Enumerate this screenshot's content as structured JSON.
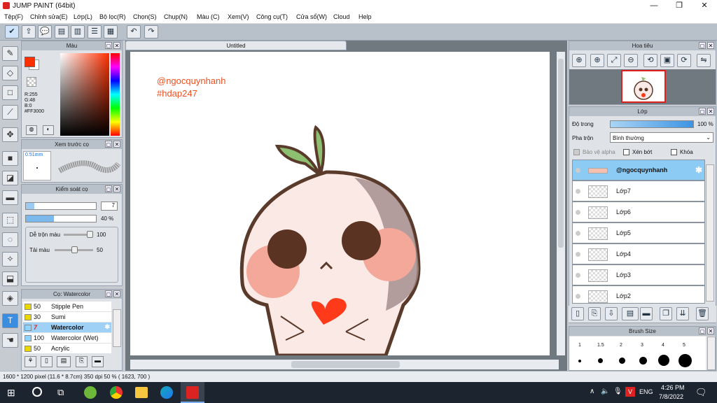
{
  "app": {
    "title": "JUMP PAINT (64bit)"
  },
  "menu": [
    "Tệp(F)",
    "Chỉnh sửa(E)",
    "Lớp(L)",
    "Bộ lọc(R)",
    "Chọn(S)",
    "Chụp(N)",
    "Màu (C)",
    "Xem(V)",
    "Công cụ(T)",
    "Cửa sổ(W)",
    "Cloud",
    "Help"
  ],
  "color_panel": {
    "title": "Màu",
    "r": "R:255",
    "g": "G:48",
    "b": "B:0",
    "hex": "#FF3000",
    "color": "#FF3000"
  },
  "brush_preview": {
    "title": "Xem trước cọ",
    "size": "0.51mm"
  },
  "brush_control": {
    "title": "Kiểm soát cọ",
    "size_value": "7",
    "opacity_value": "40 %",
    "blend_label": "Dễ trộn màu",
    "blend_value": "100",
    "resample_label": "Tải màu",
    "resample_value": "50"
  },
  "brush_list": {
    "title": "Cọ: Watercolor",
    "items": [
      {
        "size": "50",
        "name": "Stipple Pen"
      },
      {
        "size": "30",
        "name": "Sumi"
      },
      {
        "size": "7",
        "name": "Watercolor"
      },
      {
        "size": "100",
        "name": "Watercolor (Wet)"
      },
      {
        "size": "50",
        "name": "Acrylic"
      }
    ]
  },
  "canvas": {
    "tab": "Untitled",
    "text1": "@ngocquynhanh",
    "text2": "#hdap247"
  },
  "navigator": {
    "title": "Hoa tiêu"
  },
  "layers": {
    "title": "Lớp",
    "opacity_label": "Độ trong",
    "opacity_value": "100 %",
    "opacity_fraction": 1.0,
    "blend_label": "Pha trộn",
    "blend_value": "Bình thường",
    "protect_alpha": "Bảo vệ alpha",
    "clipping": "Xén bớt",
    "lock": "Khóa",
    "items": [
      "@ngocquynhanh",
      "Lớp7",
      "Lớp6",
      "Lớp5",
      "Lớp4",
      "Lớp3",
      "Lớp2"
    ]
  },
  "brush_size": {
    "title": "Brush Size",
    "sizes": [
      "1",
      "1.5",
      "2",
      "3",
      "4",
      "5"
    ]
  },
  "status": {
    "text": "1600 * 1200 pixel  (11.6 * 8.7cm)  350 dpi  50 %  ( 1623, 700 )"
  },
  "taskbar": {
    "lang": "ENG",
    "time": "4:26 PM",
    "date": "7/8/2022"
  }
}
